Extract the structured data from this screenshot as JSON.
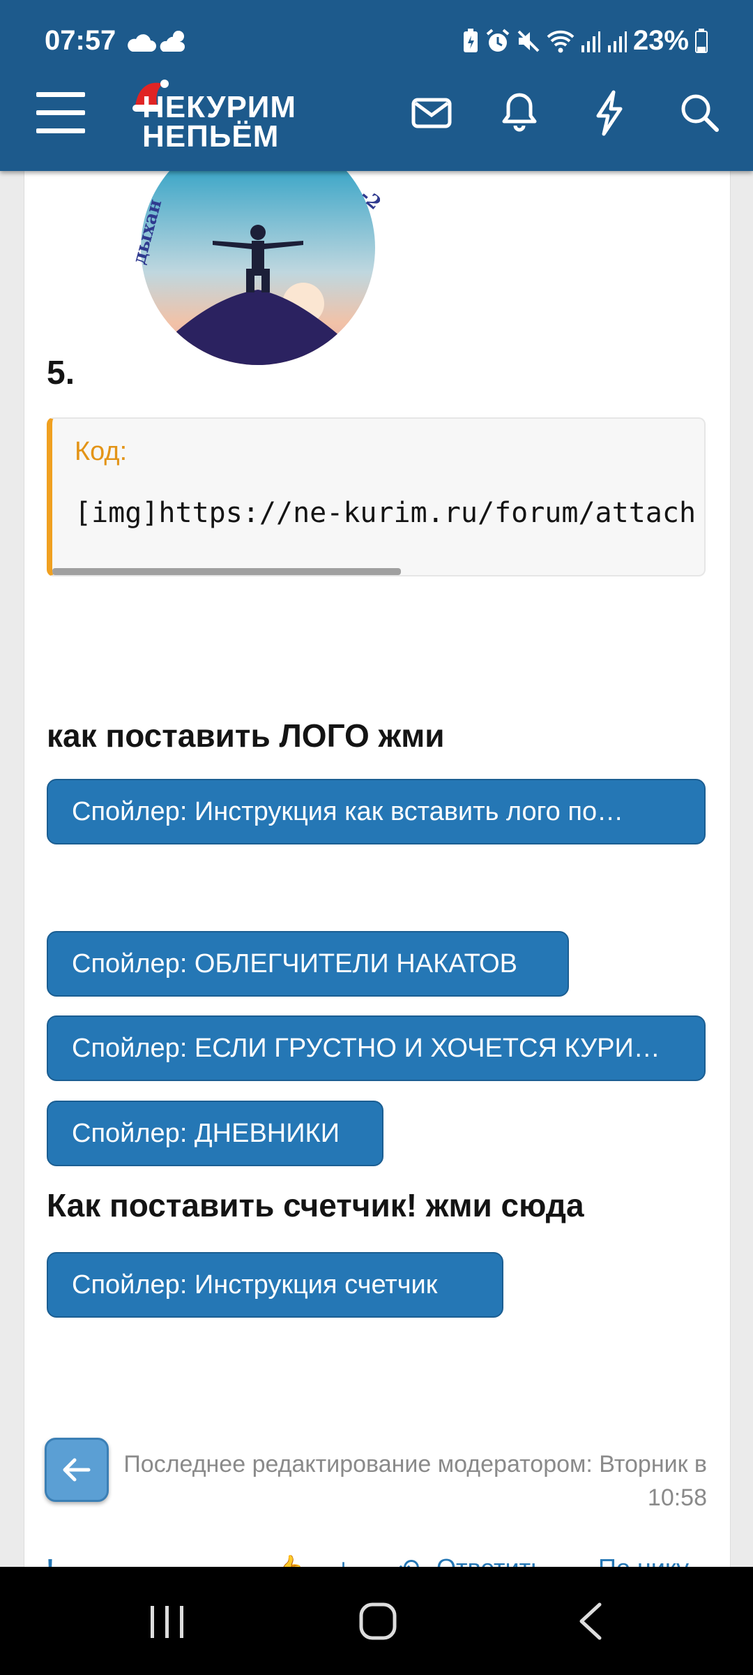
{
  "status_bar": {
    "time": "07:57",
    "battery": "23%",
    "icons": [
      "cloud-icon",
      "partly-sunny-icon",
      "battery-saver-icon",
      "alarm-icon",
      "mute-icon",
      "wifi-icon",
      "signal-icon",
      "signal-icon",
      "battery-icon"
    ]
  },
  "header": {
    "logo_line1": "НЕКУРИМ",
    "logo_line2": "НЕПЬЁМ",
    "icons": [
      "menu-icon",
      "mail-icon",
      "bell-icon",
      "lightning-icon",
      "search-icon"
    ],
    "color": "#1d5a8c"
  },
  "post": {
    "number": "5.",
    "code": {
      "label": "Код:",
      "text": "[img]https://ne-kurim.ru/forum/attach"
    },
    "heading_logo": "как поставить ЛОГО жми",
    "spoiler_logo": "Спойлер: Инструкция как вставить лого по…",
    "spoilers": [
      "Спойлер: ОБЛЕГЧИТЕЛИ НАКАТОВ",
      "Спойлер: ЕСЛИ ГРУСТНО И ХОЧЕТСЯ КУРИ…",
      "Спойлер: ДНЕВНИКИ"
    ],
    "heading_counter": "Как поставить счетчик! жми сюда",
    "spoiler_counter": "Спойлер: Инструкция счетчик",
    "edited_line1": "Последнее редактирование модератором: Вторник в",
    "edited_line2": "10:58",
    "actions": {
      "reply": "Ответить",
      "more": "По нику"
    },
    "spoiler_color": "#2577b5",
    "code_accent": "#f0a020"
  },
  "nav_bar": {
    "items": [
      "recent-apps-icon",
      "home-icon",
      "back-icon"
    ]
  }
}
